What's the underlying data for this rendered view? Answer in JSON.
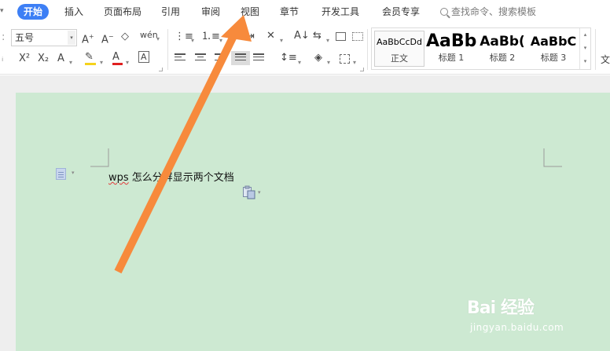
{
  "menu": {
    "tabs": [
      {
        "label": "开始",
        "active": true
      },
      {
        "label": "插入"
      },
      {
        "label": "页面布局"
      },
      {
        "label": "引用"
      },
      {
        "label": "审阅"
      },
      {
        "label": "视图"
      },
      {
        "label": "章节"
      },
      {
        "label": "开发工具"
      },
      {
        "label": "会员专享"
      }
    ],
    "search_placeholder": "查找命令、搜索模板"
  },
  "ribbon": {
    "font_size_value": "五号",
    "pinyin_label": "wén",
    "styles": [
      {
        "preview": "AaBbCcDd",
        "name": "正文"
      },
      {
        "preview": "AaBb",
        "name": "标题 1"
      },
      {
        "preview": "AaBb(",
        "name": "标题 2"
      },
      {
        "preview": "AaBbC",
        "name": "标题 3"
      }
    ],
    "overflow_label": "文"
  },
  "document": {
    "text_lead": "wps",
    "text_rest": " 怎么分屏显示两个文档"
  },
  "watermark": {
    "logo": "Bai 经验",
    "url": "jingyan.baidu.com"
  },
  "colors": {
    "accent": "#3d7ff5",
    "page_background": "#cde9d2",
    "arrow": "#f78a3c",
    "font_color_underline": "#e02020",
    "highlight_underline": "#f5d21c"
  }
}
